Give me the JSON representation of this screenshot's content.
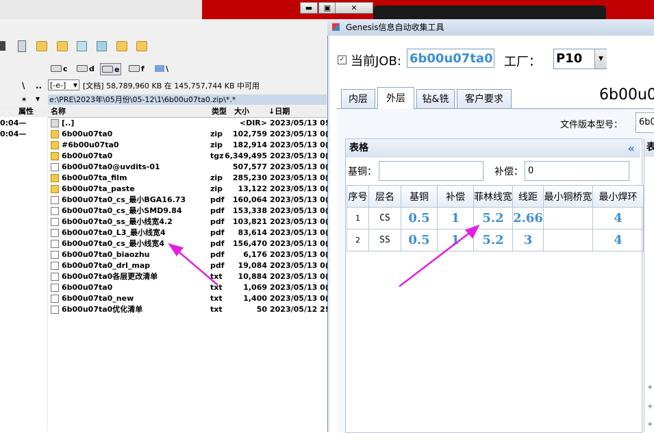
{
  "left_window": {
    "drives": [
      {
        "letter": "c"
      },
      {
        "letter": "d"
      },
      {
        "letter": "e",
        "active": true
      },
      {
        "letter": "f"
      },
      {
        "letter": "\\"
      }
    ],
    "left_path_chars": [
      "\\",
      ".."
    ],
    "star": "*",
    "drive_combo": "[-e-]",
    "drive_info": "[文档]  58,789,960 KB 在 145,757,744 KB 中可用",
    "path": "e:\\PRE\\2023年\\05月份\\05-12\\1\\6b00u07ta0.zip\\*.*",
    "left_header": "属性",
    "left_times": [
      "0:04—",
      "0:04—"
    ],
    "columns": [
      "名称",
      "类型",
      "大小",
      "↓日期"
    ],
    "files": [
      {
        "icon": "up",
        "name": "[..]",
        "type": "",
        "size": "<DIR>",
        "date": "2023/05/13 0!"
      },
      {
        "icon": "zip",
        "name": "6b00u07ta0",
        "type": "zip",
        "size": "102,759",
        "date": "2023/05/13 0("
      },
      {
        "icon": "zip",
        "name": "#6b00u07ta0",
        "type": "zip",
        "size": "182,914",
        "date": "2023/05/13 0("
      },
      {
        "icon": "zip",
        "name": "6b00u07ta0",
        "type": "tgz",
        "size": "6,349,495",
        "date": "2023/05/13 0("
      },
      {
        "icon": "file",
        "name": "6b00u07ta0@uvdits-01",
        "type": "",
        "size": "507,577",
        "date": "2023/05/13 0("
      },
      {
        "icon": "zip",
        "name": "6b00u07ta_film",
        "type": "zip",
        "size": "285,230",
        "date": "2023/05/13 0("
      },
      {
        "icon": "zip",
        "name": "6b00u07ta_paste",
        "type": "zip",
        "size": "13,122",
        "date": "2023/05/13 0("
      },
      {
        "icon": "pdf",
        "name": "6b00u07ta0_cs_最小BGA16.73",
        "type": "pdf",
        "size": "160,064",
        "date": "2023/05/13 0("
      },
      {
        "icon": "pdf",
        "name": "6b00u07ta0_cs_最小SMD9.84",
        "type": "pdf",
        "size": "153,338",
        "date": "2023/05/13 0("
      },
      {
        "icon": "pdf",
        "name": "6b00u07ta0_ss_最小线宽4.2",
        "type": "pdf",
        "size": "103,821",
        "date": "2023/05/13 0("
      },
      {
        "icon": "pdf",
        "name": "6b00u07ta0_L3_最小线宽4",
        "type": "pdf",
        "size": "83,614",
        "date": "2023/05/13 0("
      },
      {
        "icon": "pdf",
        "name": "6b00u07ta0_cs_最小线宽4",
        "type": "pdf",
        "size": "156,470",
        "date": "2023/05/13 0("
      },
      {
        "icon": "pdf",
        "name": "6b00u07ta0_biaozhu",
        "type": "pdf",
        "size": "6,176",
        "date": "2023/05/13 0("
      },
      {
        "icon": "pdf",
        "name": "6b00u07ta0_drl_map",
        "type": "pdf",
        "size": "19,084",
        "date": "2023/05/13 0("
      },
      {
        "icon": "txt",
        "name": "6b00u07ta0各层更改清单",
        "type": "txt",
        "size": "10,884",
        "date": "2023/05/13 0("
      },
      {
        "icon": "txt",
        "name": "6b00u07ta0",
        "type": "txt",
        "size": "1,069",
        "date": "2023/05/13 0("
      },
      {
        "icon": "txt",
        "name": "6b00u07ta0_new",
        "type": "txt",
        "size": "1,400",
        "date": "2023/05/13 0("
      },
      {
        "icon": "txt",
        "name": "6b00u07ta0优化清单",
        "type": "txt",
        "size": "50",
        "date": "2023/05/12 2!"
      }
    ]
  },
  "window_controls": {
    "minimize": "▬",
    "maximize": "▣",
    "close": "✕"
  },
  "genesis": {
    "title": "Genesis信息自动收集工具",
    "job_label": "当前JOB:",
    "job_value": "6b00u07ta0",
    "factory_label": "工厂：",
    "factory_value": "P10",
    "tabs": [
      "内层",
      "外层",
      "钻&铣",
      "客户要求"
    ],
    "active_tab": "外层",
    "job_heading": "6b00u0",
    "version_label": "文件版本型号：",
    "version_value": "6b0",
    "panel_title": "表格",
    "collapse_glyph": "«",
    "right_panel_title": "表",
    "base_copper_label": "基铜：",
    "base_copper_value": "",
    "comp_label": "补偿：",
    "comp_value": "0",
    "grid_columns": [
      "序号",
      "层名",
      "基铜",
      "补偿",
      "菲林线宽",
      "线距",
      "最小铜桥宽",
      "最小焊环"
    ],
    "grid_rows": [
      {
        "seq": "1",
        "layer": "CS",
        "base": "0.5",
        "comp": "1",
        "film": "5.2",
        "space": "2.66",
        "bridge": "",
        "ring": "4"
      },
      {
        "seq": "2",
        "layer": "SS",
        "base": "0.5",
        "comp": "1",
        "film": "5.2",
        "space": "3",
        "bridge": "",
        "ring": "4"
      }
    ],
    "accent_color": "#3a8fd6",
    "arrow_color": "#e020e0"
  }
}
